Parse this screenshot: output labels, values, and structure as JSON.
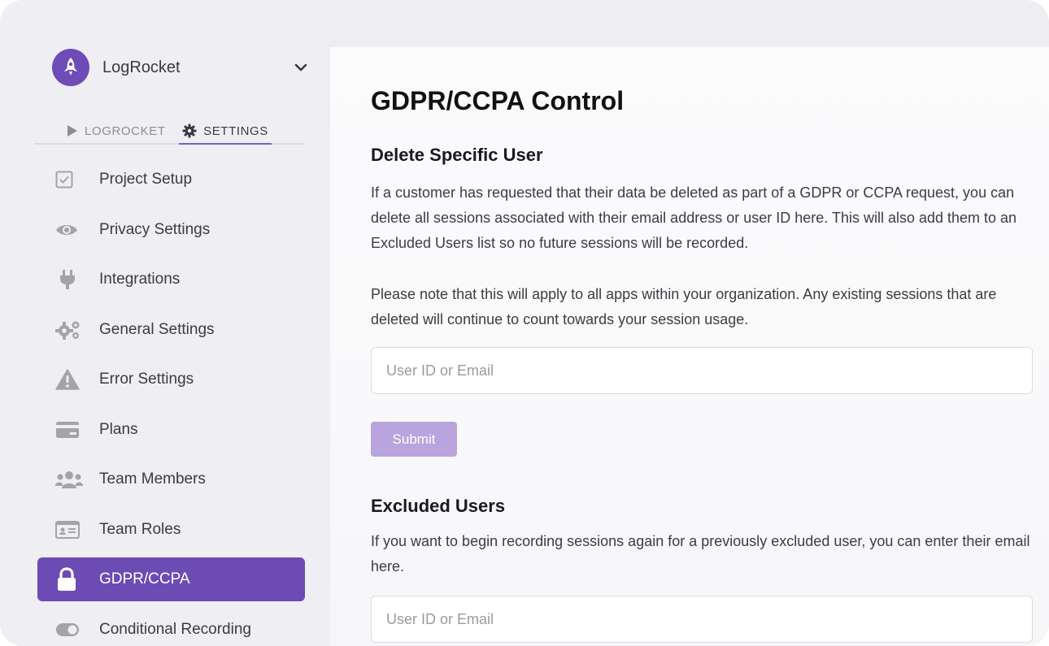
{
  "org": {
    "name": "LogRocket"
  },
  "mode_tabs": [
    {
      "label": "LOGROCKET",
      "icon": "play-icon",
      "active": false
    },
    {
      "label": "SETTINGS",
      "icon": "gear-icon",
      "active": true
    }
  ],
  "nav": {
    "items": [
      {
        "label": "Project Setup",
        "icon": "checkbox-icon"
      },
      {
        "label": "Privacy Settings",
        "icon": "eye-icon"
      },
      {
        "label": "Integrations",
        "icon": "plug-icon"
      },
      {
        "label": "General Settings",
        "icon": "gears-icon"
      },
      {
        "label": "Error Settings",
        "icon": "warning-icon"
      },
      {
        "label": "Plans",
        "icon": "credit-card-icon"
      },
      {
        "label": "Team Members",
        "icon": "users-icon"
      },
      {
        "label": "Team Roles",
        "icon": "id-card-icon"
      },
      {
        "label": "GDPR/CCPA",
        "icon": "lock-icon",
        "active": true
      },
      {
        "label": "Conditional Recording",
        "icon": "toggle-icon"
      }
    ]
  },
  "main": {
    "title": "GDPR/CCPA Control",
    "delete_section": {
      "title": "Delete Specific User",
      "para1": "If a customer has requested that their data be deleted as part of a GDPR or CCPA request, you can delete all sessions associated with their email address or user ID here. This will also add them to an Excluded Users list so no future sessions will be recorded.",
      "para2": "Please note that this will apply to all apps within your organization. Any existing sessions that are deleted will continue to count towards your session usage.",
      "input_placeholder": "User ID or Email",
      "submit_label": "Submit"
    },
    "excluded_section": {
      "title": "Excluded Users",
      "para": "If you want to begin recording sessions again for a previously excluded user, you can enter their email here.",
      "input_placeholder": "User ID or Email"
    }
  },
  "colors": {
    "accent": "#6d4bb5",
    "accent_light": "#b9a4dd",
    "sidebar_bg": "#efeef3"
  }
}
